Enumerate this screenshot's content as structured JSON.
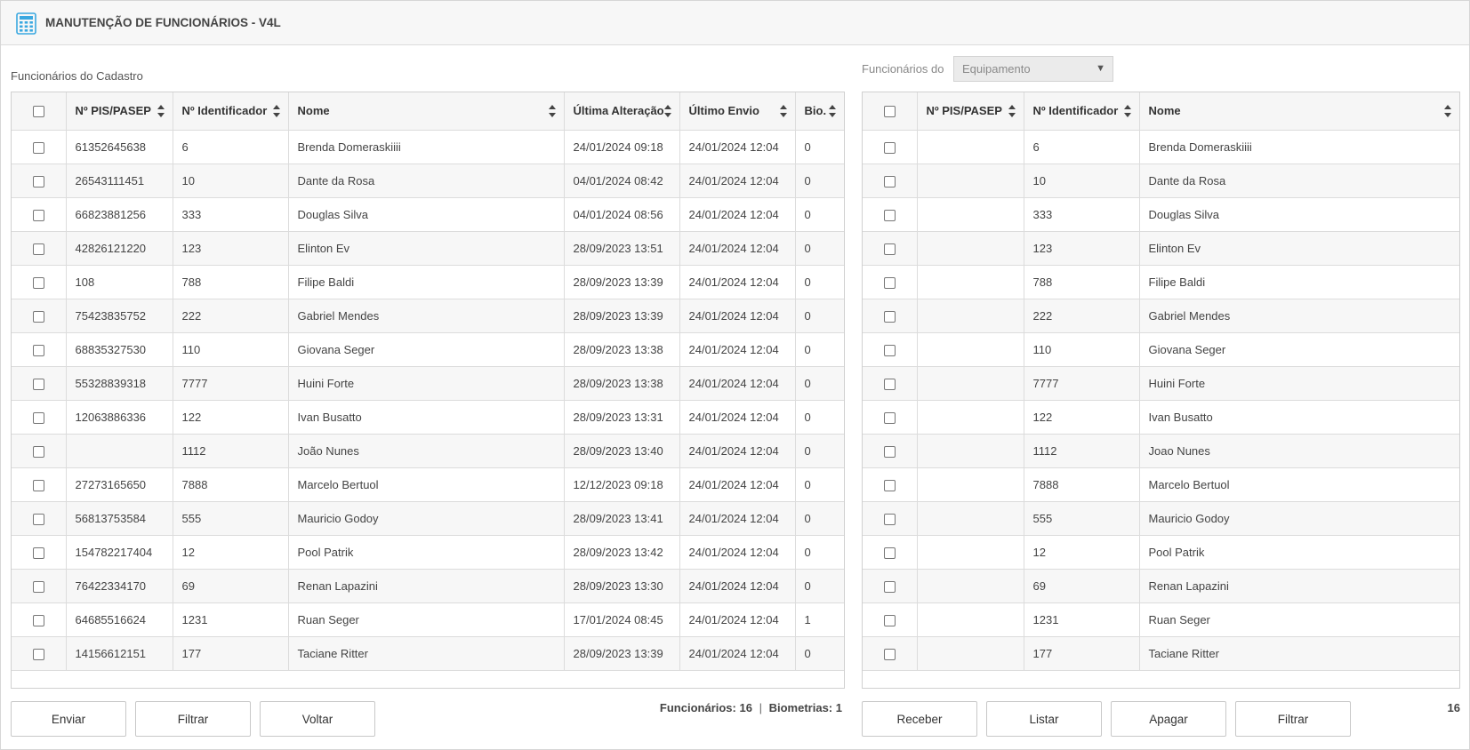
{
  "header": {
    "title": "MANUTENÇÃO DE FUNCIONÁRIOS - V4L",
    "icon": "calculator-icon",
    "icon_color": "#3aa8e0"
  },
  "left": {
    "label": "Funcionários do Cadastro",
    "columns": [
      "Nº PIS/PASEP",
      "Nº Identificador",
      "Nome",
      "Última Alteração",
      "Último Envio",
      "Bio."
    ],
    "rows": [
      [
        "61352645638",
        "6",
        "Brenda Domeraskiiii",
        "24/01/2024 09:18",
        "24/01/2024 12:04",
        "0"
      ],
      [
        "26543111451",
        "10",
        "Dante da Rosa",
        "04/01/2024 08:42",
        "24/01/2024 12:04",
        "0"
      ],
      [
        "66823881256",
        "333",
        "Douglas Silva",
        "04/01/2024 08:56",
        "24/01/2024 12:04",
        "0"
      ],
      [
        "42826121220",
        "123",
        "Elinton Ev",
        "28/09/2023 13:51",
        "24/01/2024 12:04",
        "0"
      ],
      [
        "108",
        "788",
        "Filipe Baldi",
        "28/09/2023 13:39",
        "24/01/2024 12:04",
        "0"
      ],
      [
        "75423835752",
        "222",
        "Gabriel Mendes",
        "28/09/2023 13:39",
        "24/01/2024 12:04",
        "0"
      ],
      [
        "68835327530",
        "110",
        "Giovana Seger",
        "28/09/2023 13:38",
        "24/01/2024 12:04",
        "0"
      ],
      [
        "55328839318",
        "7777",
        "Huini Forte",
        "28/09/2023 13:38",
        "24/01/2024 12:04",
        "0"
      ],
      [
        "12063886336",
        "122",
        "Ivan Busatto",
        "28/09/2023 13:31",
        "24/01/2024 12:04",
        "0"
      ],
      [
        "",
        "1112",
        "João Nunes",
        "28/09/2023 13:40",
        "24/01/2024 12:04",
        "0"
      ],
      [
        "27273165650",
        "7888",
        "Marcelo Bertuol",
        "12/12/2023 09:18",
        "24/01/2024 12:04",
        "0"
      ],
      [
        "56813753584",
        "555",
        "Mauricio Godoy",
        "28/09/2023 13:41",
        "24/01/2024 12:04",
        "0"
      ],
      [
        "154782217404",
        "12",
        "Pool Patrik",
        "28/09/2023 13:42",
        "24/01/2024 12:04",
        "0"
      ],
      [
        "76422334170",
        "69",
        "Renan Lapazini",
        "28/09/2023 13:30",
        "24/01/2024 12:04",
        "0"
      ],
      [
        "64685516624",
        "1231",
        "Ruan Seger",
        "17/01/2024 08:45",
        "24/01/2024 12:04",
        "1"
      ],
      [
        "14156612151",
        "177",
        "Taciane Ritter",
        "28/09/2023 13:39",
        "24/01/2024 12:04",
        "0"
      ]
    ],
    "buttons": [
      "Enviar",
      "Filtrar",
      "Voltar"
    ],
    "summary": {
      "funcionarios_label": "Funcionários:",
      "funcionarios_value": "16",
      "separator": "|",
      "biometrias_label": "Biometrias:",
      "biometrias_value": "1"
    }
  },
  "right": {
    "label": "Funcionários do",
    "select_value": "Equipamento",
    "columns": [
      "Nº PIS/PASEP",
      "Nº Identificador",
      "Nome"
    ],
    "rows": [
      [
        "",
        "6",
        "Brenda Domeraskiiii"
      ],
      [
        "",
        "10",
        "Dante da Rosa"
      ],
      [
        "",
        "333",
        "Douglas Silva"
      ],
      [
        "",
        "123",
        "Elinton Ev"
      ],
      [
        "",
        "788",
        "Filipe Baldi"
      ],
      [
        "",
        "222",
        "Gabriel Mendes"
      ],
      [
        "",
        "110",
        "Giovana Seger"
      ],
      [
        "",
        "7777",
        "Huini Forte"
      ],
      [
        "",
        "122",
        "Ivan Busatto"
      ],
      [
        "",
        "1112",
        "Joao Nunes"
      ],
      [
        "",
        "7888",
        "Marcelo Bertuol"
      ],
      [
        "",
        "555",
        "Mauricio Godoy"
      ],
      [
        "",
        "12",
        "Pool Patrik"
      ],
      [
        "",
        "69",
        "Renan Lapazini"
      ],
      [
        "",
        "1231",
        "Ruan Seger"
      ],
      [
        "",
        "177",
        "Taciane Ritter"
      ]
    ],
    "buttons": [
      "Receber",
      "Listar",
      "Apagar",
      "Filtrar"
    ],
    "count": "16"
  }
}
